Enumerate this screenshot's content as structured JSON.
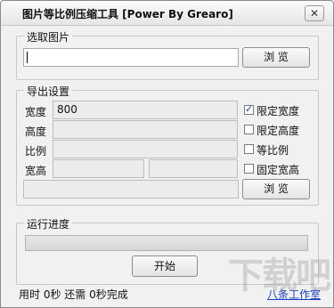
{
  "window": {
    "title": "图片等比例压缩工具 [Power By Grearo]",
    "close_glyph": "✕"
  },
  "select_group": {
    "label": "选取图片",
    "path_value": "",
    "browse_label": "浏 览"
  },
  "export_group": {
    "label": "导出设置",
    "width_label": "宽度",
    "width_value": "800",
    "height_label": "高度",
    "height_value": "",
    "ratio_label": "比例",
    "ratio_value": "",
    "wh_label": "宽高",
    "wh_value_1": "",
    "wh_value_2": "",
    "out_path_value": "",
    "browse_label": "浏 览",
    "checkboxes": [
      {
        "label": "限定宽度",
        "checked": true
      },
      {
        "label": "限定高度",
        "checked": false
      },
      {
        "label": "等比例",
        "checked": false
      },
      {
        "label": "固定宽高",
        "checked": false
      }
    ]
  },
  "progress_group": {
    "label": "运行进度",
    "progress_fraction": 0,
    "start_label": "开始"
  },
  "status": {
    "text": "用时 0秒 还需 0秒完成",
    "link_text": "八条工作室"
  },
  "watermark_text": "下载吧",
  "colors": {
    "link": "#1a3fbf",
    "window_bg": "#f1f1f1"
  }
}
